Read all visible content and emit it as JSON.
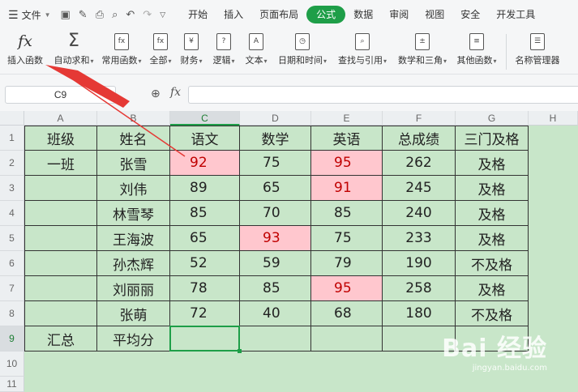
{
  "menubar": {
    "file_label": "文件",
    "tabs": [
      "开始",
      "插入",
      "页面布局",
      "公式",
      "数据",
      "审阅",
      "视图",
      "安全",
      "开发工具"
    ],
    "active_tab": "公式"
  },
  "ribbon": {
    "insert_function": "插入函数",
    "autosum": "自动求和",
    "common": "常用函数",
    "all": "全部",
    "finance": "财务",
    "logic": "逻辑",
    "text": "文本",
    "datetime": "日期和时间",
    "lookup": "查找与引用",
    "math": "数学和三角",
    "other": "其他函数",
    "name_manager": "名称管理器"
  },
  "formula_bar": {
    "name_box": "C9",
    "formula": ""
  },
  "columns": [
    "A",
    "B",
    "C",
    "D",
    "E",
    "F",
    "G",
    "H"
  ],
  "rows": [
    "1",
    "2",
    "3",
    "4",
    "5",
    "6",
    "7",
    "8",
    "9",
    "10",
    "11"
  ],
  "table": [
    [
      "班级",
      "姓名",
      "语文",
      "数学",
      "英语",
      "总成绩",
      "三门及格"
    ],
    [
      "一班",
      "张雪",
      "92",
      "75",
      "95",
      "262",
      "及格"
    ],
    [
      "",
      "刘伟",
      "89",
      "65",
      "91",
      "245",
      "及格"
    ],
    [
      "",
      "林雪琴",
      "85",
      "70",
      "85",
      "240",
      "及格"
    ],
    [
      "",
      "王海波",
      "65",
      "93",
      "75",
      "233",
      "及格"
    ],
    [
      "",
      "孙杰辉",
      "52",
      "59",
      "79",
      "190",
      "不及格"
    ],
    [
      "",
      "刘丽丽",
      "78",
      "85",
      "95",
      "258",
      "及格"
    ],
    [
      "",
      "张萌",
      "72",
      "40",
      "68",
      "180",
      "不及格"
    ],
    [
      "汇总",
      "平均分",
      "",
      "",
      "",
      "",
      ""
    ]
  ],
  "highlight_color": "#ffc7ce",
  "sheet_bg": "#c8e6c9",
  "accent": "#1e9e48",
  "watermark": {
    "brand": "Bai 经验",
    "url": "jingyan.baidu.com"
  }
}
